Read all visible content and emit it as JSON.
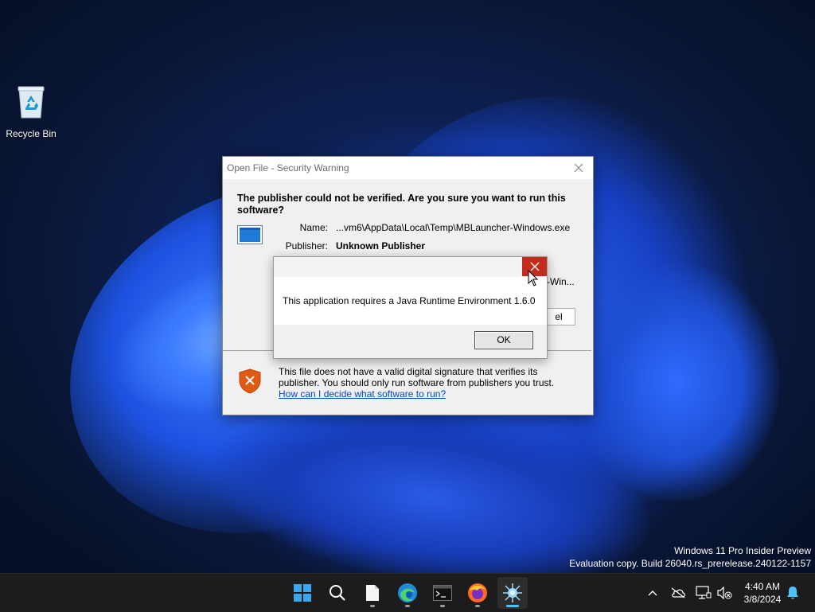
{
  "desktop": {
    "icons": [
      {
        "label": "Recycle Bin"
      }
    ],
    "watermark": {
      "line1": "Windows 11 Pro Insider Preview",
      "line2": "Evaluation copy. Build 26040.rs_prerelease.240122-1157"
    }
  },
  "security_dialog": {
    "title": "Open File - Security Warning",
    "heading": "The publisher could not be verified.  Are you sure you want to run this software?",
    "name_label": "Name:",
    "name_value": "...vm6\\AppData\\Local\\Temp\\MBLauncher-Windows.exe",
    "publisher_label": "Publisher:",
    "publisher_value": "Unknown Publisher",
    "hidden_value_fragment": "-Win...",
    "cancel_fragment": "el",
    "warning_text": "This file does not have a valid digital signature that verifies its publisher.  You should only run software from publishers you trust.",
    "help_link": "How can I decide what software to run?"
  },
  "java_dialog": {
    "message": "This application requires a Java Runtime Environment 1.6.0",
    "ok_label": "OK"
  },
  "taskbar": {
    "apps": [
      "start",
      "search",
      "file-explorer",
      "edge",
      "terminal",
      "firefox",
      "java-app"
    ],
    "time": "4:40 AM",
    "date": "3/8/2024"
  },
  "colors": {
    "close_red": "#c42b1c",
    "link_blue": "#0645c7",
    "taskbar_bg": "#1c1c1c",
    "accent": "#4cc2ff"
  }
}
